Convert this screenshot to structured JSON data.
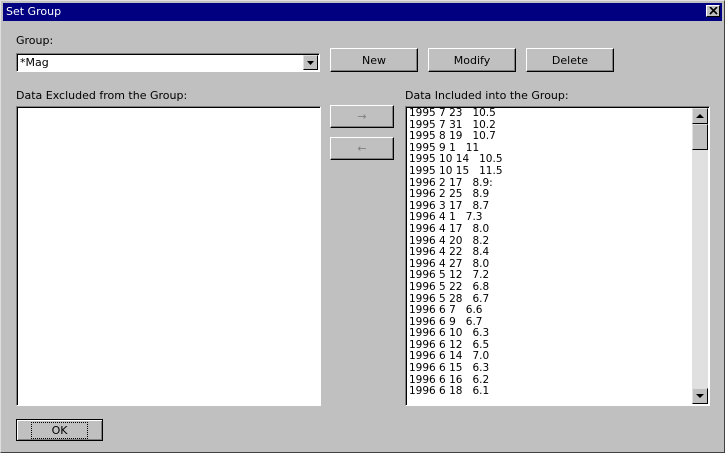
{
  "window": {
    "title": "Set Group"
  },
  "group": {
    "label": "Group:",
    "value": "*Mag"
  },
  "buttons": {
    "new": "New",
    "modify": "Modify",
    "delete": "Delete",
    "ok": "OK"
  },
  "excluded": {
    "label": "Data Excluded from the Group:",
    "items": []
  },
  "included": {
    "label": "Data Included into the Group:",
    "items": [
      "1995 7 23   10.5",
      "1995 7 31   10.2",
      "1995 8 19   10.7",
      "1995 9 1   11",
      "1995 10 14   10.5",
      "1995 10 15   11.5",
      "1996 2 17   8.9:",
      "1996 2 25   8.9",
      "1996 3 17   8.7",
      "1996 4 1   7.3",
      "1996 4 17   8.0",
      "1996 4 20   8.2",
      "1996 4 22   8.4",
      "1996 4 27   8.0",
      "1996 5 12   7.2",
      "1996 5 22   6.8",
      "1996 5 28   6.7",
      "1996 6 7   6.6",
      "1996 6 9   6.7",
      "1996 6 10   6.3",
      "1996 6 12   6.5",
      "1996 6 14   7.0",
      "1996 6 15   6.3",
      "1996 6 16   6.2",
      "1996 6 18   6.1"
    ]
  },
  "arrows": {
    "include": "→",
    "exclude": "←"
  },
  "icons": {
    "close": "close-icon",
    "dropdown": "dropdown-arrow-icon",
    "scroll_up": "scroll-up-icon",
    "scroll_down": "scroll-down-icon"
  }
}
